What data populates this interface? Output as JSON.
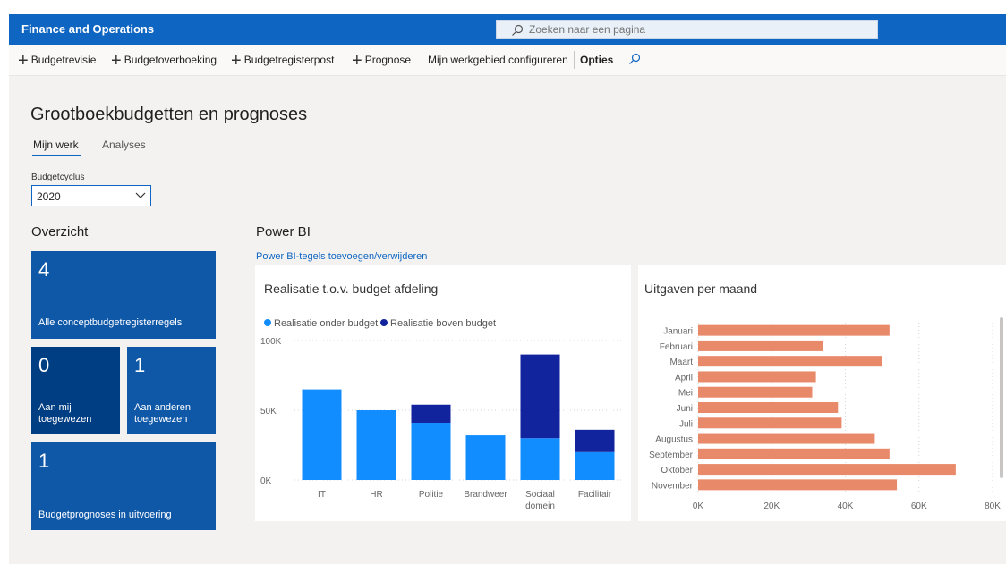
{
  "app": {
    "title": "Finance and Operations",
    "search_placeholder": "Zoeken naar een pagina"
  },
  "commands": {
    "budgetrevisie": "Budgetrevisie",
    "budgetoverboeking": "Budgetoverboeking",
    "budgetregisterpost": "Budgetregisterpost",
    "prognose": "Prognose",
    "configure": "Mijn werkgebied configureren",
    "opties": "Opties"
  },
  "page": {
    "title": "Grootboekbudgetten en prognoses",
    "tabs": [
      {
        "label": "Mijn werk",
        "active": true
      },
      {
        "label": "Analyses",
        "active": false
      }
    ],
    "budgetcyclus_label": "Budgetcyclus",
    "budgetcyclus_value": "2020"
  },
  "overview": {
    "heading": "Overzicht",
    "tiles": [
      {
        "count": "4",
        "label": "Alle conceptbudgetregisterregels"
      },
      {
        "count": "0",
        "label": "Aan mij toegewezen"
      },
      {
        "count": "1",
        "label": "Aan anderen toegewezen"
      },
      {
        "count": "1",
        "label": "Budgetprognoses in uitvoering"
      }
    ]
  },
  "powerbi": {
    "heading": "Power BI",
    "link": "Power BI-tegels toevoegen/verwijderen"
  },
  "colors": {
    "header": "#0f65c2",
    "tile": "#0f58a8",
    "tile_dark": "#003e83",
    "onder": "#118dff",
    "boven": "#12239e",
    "bar": "#e8896a"
  },
  "chart_data": [
    {
      "type": "bar",
      "title": "Realisatie t.o.v. budget afdeling",
      "stacked": true,
      "categories": [
        "IT",
        "HR",
        "Politie",
        "Brandweer",
        "Sociaal domein",
        "Facilitair"
      ],
      "series": [
        {
          "name": "Realisatie onder budget",
          "values": [
            65000,
            50000,
            41000,
            32000,
            30000,
            20000
          ]
        },
        {
          "name": "Realisatie boven budget",
          "values": [
            0,
            0,
            13000,
            0,
            60000,
            16000
          ]
        }
      ],
      "ylim": [
        0,
        100000
      ],
      "yticks": [
        "0K",
        "50K",
        "100K"
      ],
      "legend": "top-left",
      "grid": true
    },
    {
      "type": "bar",
      "orientation": "horizontal",
      "title": "Uitgaven per maand",
      "categories": [
        "Januari",
        "Februari",
        "Maart",
        "April",
        "Mei",
        "Juni",
        "Juli",
        "Augustus",
        "September",
        "Oktober",
        "November"
      ],
      "values": [
        52000,
        34000,
        50000,
        32000,
        31000,
        38000,
        39000,
        48000,
        52000,
        70000,
        54000
      ],
      "xlim": [
        0,
        80000
      ],
      "xticks": [
        "0K",
        "20K",
        "40K",
        "60K",
        "80K"
      ],
      "grid": true
    }
  ]
}
